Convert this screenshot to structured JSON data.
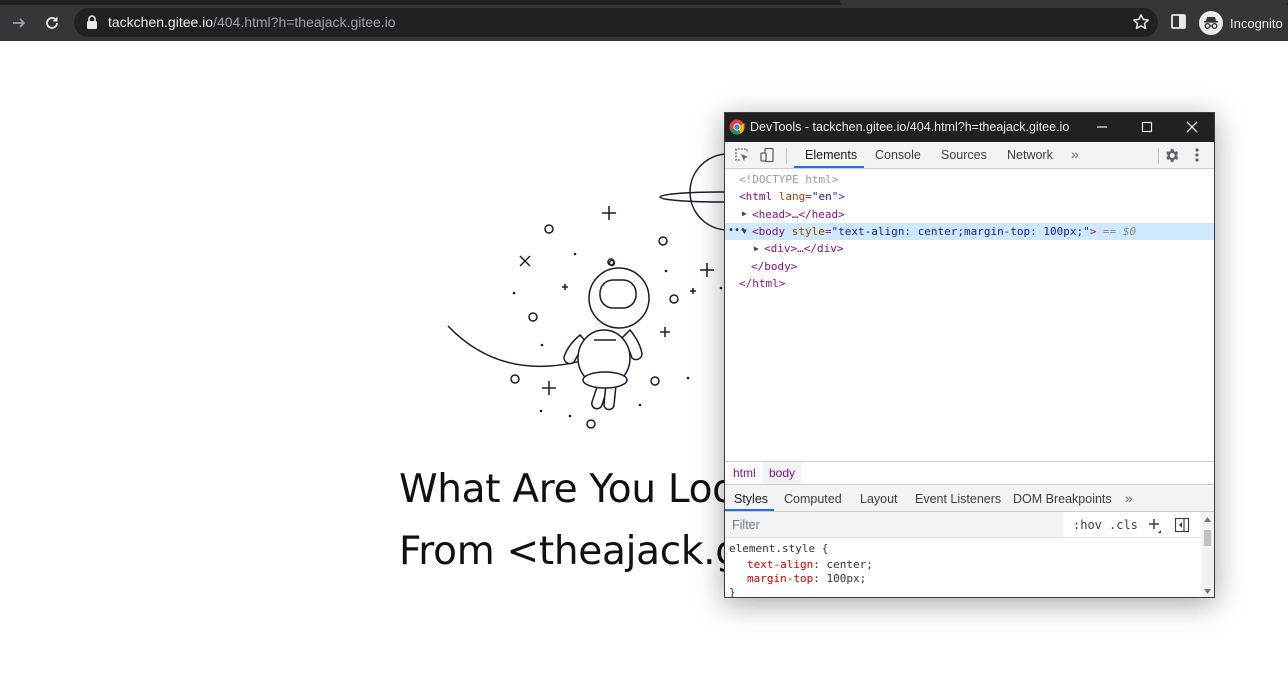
{
  "browser": {
    "url_domain": "tackchen.gitee.io",
    "url_path": "/404.html?h=theajack.gitee.io",
    "profile_label": "Incognito"
  },
  "page": {
    "heading_line1": "What Are You Loo",
    "heading_line2": "From <theajack.g"
  },
  "devtools": {
    "title": "DevTools - tackchen.gitee.io/404.html?h=theajack.gitee.io",
    "tabs": [
      {
        "label": "Elements"
      },
      {
        "label": "Console"
      },
      {
        "label": "Sources"
      },
      {
        "label": "Network"
      }
    ],
    "more_glyph": "»",
    "dom": {
      "doctype": "<!DOCTYPE html>",
      "html_open_tag": "<html",
      "html_attr": "lang",
      "html_attr_val": "\"en\"",
      "html_close_bracket": ">",
      "head": "<head>…</head>",
      "body_open": "<body",
      "body_attr": "style",
      "body_attr_val": "\"text-align: center;margin-top: 100px;\"",
      "body_close_bracket": ">",
      "selected_marker": "== $0",
      "div": "<div>…</div>",
      "body_close": "</body>",
      "html_close": "</html>"
    },
    "breadcrumbs": [
      "html",
      "body"
    ],
    "style_tabs": [
      {
        "label": "Styles"
      },
      {
        "label": "Computed"
      },
      {
        "label": "Layout"
      },
      {
        "label": "Event Listeners"
      },
      {
        "label": "DOM Breakpoints"
      }
    ],
    "filter_placeholder": "Filter",
    "hov_label": ":hov",
    "cls_label": ".cls",
    "styles_rule": {
      "selector": "element.style {",
      "props": [
        {
          "name": "text-align",
          "value": "center;"
        },
        {
          "name": "margin-top",
          "value": "100px;"
        }
      ],
      "close": "}"
    }
  }
}
